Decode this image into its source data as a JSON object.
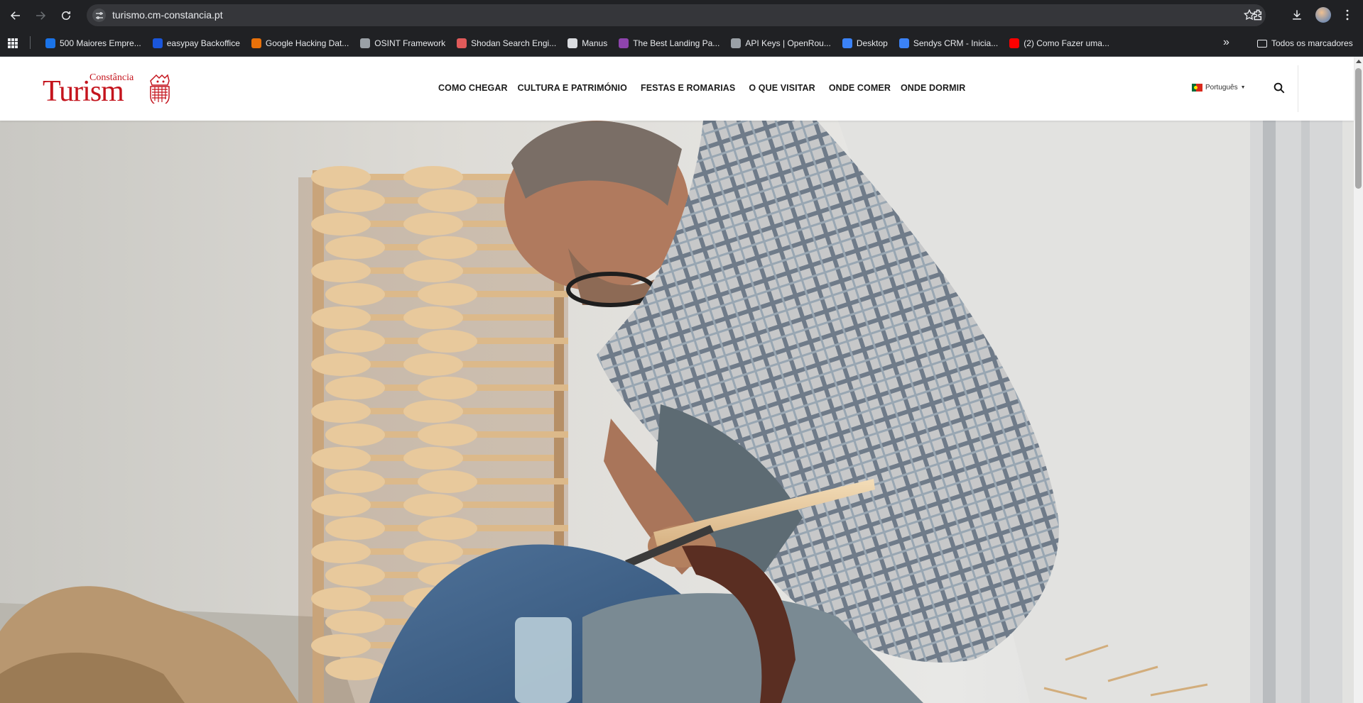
{
  "browser": {
    "url": "turismo.cm-constancia.pt",
    "bookmarks": [
      {
        "label": "500 Maiores Empre...",
        "icon": "bookmark-500-maiores-icon",
        "color": "#1a73e8"
      },
      {
        "label": "easypay Backoffice",
        "icon": "easypay-icon",
        "color": "#1a56db"
      },
      {
        "label": "Google Hacking Dat...",
        "icon": "google-hacking-icon",
        "color": "#e8710a"
      },
      {
        "label": "OSINT Framework",
        "icon": "globe-icon",
        "color": "#9aa0a6"
      },
      {
        "label": "Shodan Search Engi...",
        "icon": "shodan-icon",
        "color": "#e05a5a"
      },
      {
        "label": "Manus",
        "icon": "manus-icon",
        "color": "#dadce0"
      },
      {
        "label": "The Best Landing Pa...",
        "icon": "landing-page-icon",
        "color": "#8e44ad"
      },
      {
        "label": "API Keys | OpenRou...",
        "icon": "openrouter-icon",
        "color": "#9aa0a6"
      },
      {
        "label": "Desktop",
        "icon": "desktop-icon",
        "color": "#3b82f6"
      },
      {
        "label": "Sendys CRM - Inicia...",
        "icon": "sendys-icon",
        "color": "#3b82f6"
      },
      {
        "label": "(2) Como Fazer uma...",
        "icon": "youtube-icon",
        "color": "#ff0000"
      }
    ],
    "all_bookmarks_label": "Todos os marcadores"
  },
  "site": {
    "logo_top": "Constância",
    "logo_main": "Turism",
    "nav": [
      "COMO CHEGAR",
      "CULTURA E PATRIMÓNIO",
      "FESTAS E ROMARIAS",
      "O QUE VISITAR",
      "ONDE COMER",
      "ONDE DORMIR"
    ],
    "language": "Português",
    "brand_color": "#c4141d"
  },
  "hero": {
    "image": "artisan-carving-wooden-spoons-photo"
  }
}
